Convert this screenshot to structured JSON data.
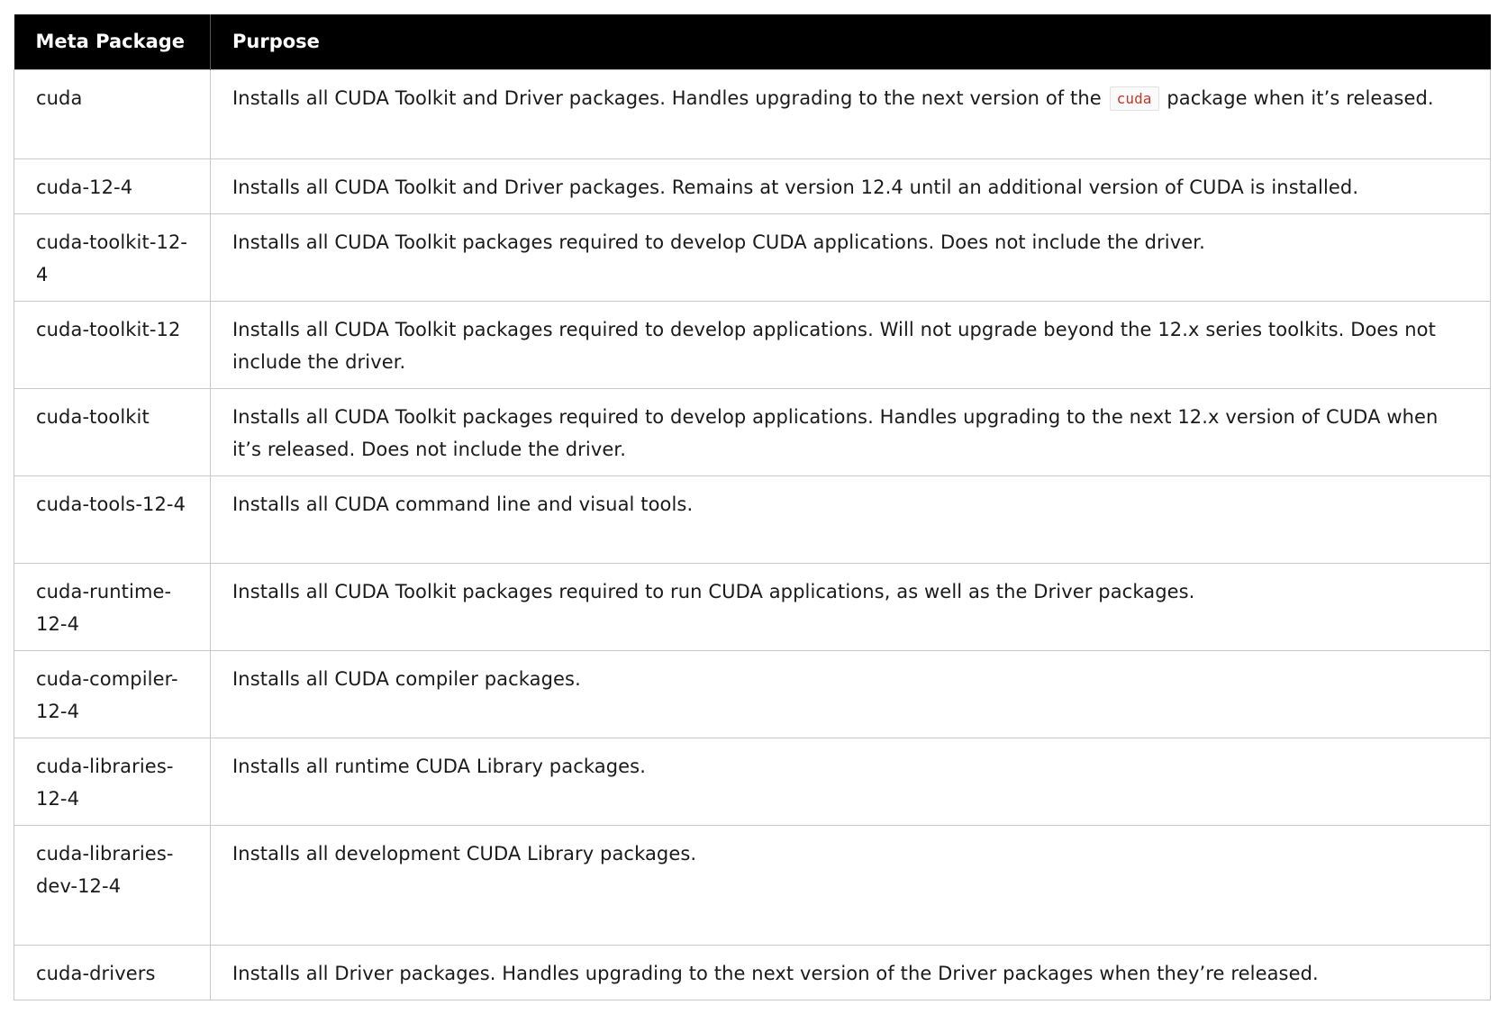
{
  "table": {
    "headers": [
      "Meta Package",
      "Purpose"
    ],
    "rows": [
      {
        "package": "cuda",
        "purpose_before": "Installs all CUDA Toolkit and Driver packages. Handles upgrading to the next version of the",
        "purpose_code": "cuda",
        "purpose_after": "package when it’s released."
      },
      {
        "package": "cuda-12-4",
        "purpose": "Installs all CUDA Toolkit and Driver packages. Remains at version 12.4 until an additional version of CUDA is installed."
      },
      {
        "package": "cuda-toolkit-12-4",
        "purpose": "Installs all CUDA Toolkit packages required to develop CUDA applications. Does not include the driver."
      },
      {
        "package": "cuda-toolkit-12",
        "purpose": "Installs all CUDA Toolkit packages required to develop applications. Will not upgrade beyond the 12.x series toolkits. Does not include the driver."
      },
      {
        "package": "cuda-toolkit",
        "purpose": "Installs all CUDA Toolkit packages required to develop applications. Handles upgrading to the next 12.x version of CUDA when it’s released. Does not include the driver."
      },
      {
        "package": "cuda-tools-12-4",
        "purpose": "Installs all CUDA command line and visual tools."
      },
      {
        "package": "cuda-runtime-12-4",
        "purpose": "Installs all CUDA Toolkit packages required to run CUDA applications, as well as the Driver packages."
      },
      {
        "package": "cuda-compiler-12-4",
        "purpose": "Installs all CUDA compiler packages."
      },
      {
        "package": "cuda-libraries-12-4",
        "purpose": "Installs all runtime CUDA Library packages."
      },
      {
        "package": "cuda-libraries-dev-12-4",
        "purpose": "Installs all development CUDA Library packages."
      },
      {
        "package": "cuda-drivers",
        "purpose": "Installs all Driver packages. Handles upgrading to the next version of the Driver packages when they’re released."
      }
    ]
  }
}
